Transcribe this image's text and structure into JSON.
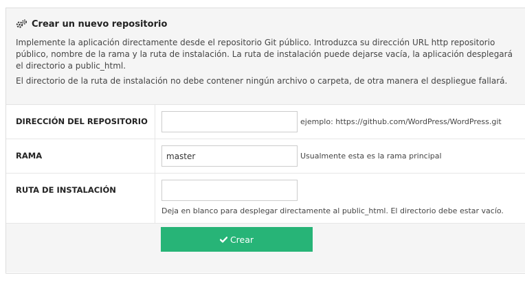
{
  "panel": {
    "title": "Crear un nuevo repositorio",
    "title_icon": "gears-icon",
    "description": [
      "Implemente la aplicación directamente desde el repositorio Git público. Introduzca su dirección URL http repositorio público, nombre de la rama y la ruta de instalación. La ruta de instalación puede dejarse vacía, la aplicación desplegará el directorio a public_html.",
      "El directorio de la ruta de instalación no debe contener ningún archivo o carpeta, de otra manera el despliegue fallará."
    ]
  },
  "form": {
    "repo": {
      "label": "DIRECCIÓN DEL REPOSITORIO",
      "value": "",
      "hint": "ejemplo: https://github.com/WordPress/WordPress.git"
    },
    "branch": {
      "label": "RAMA",
      "value": "master",
      "hint": "Usualmente esta es la rama principal"
    },
    "path": {
      "label": "RUTA DE INSTALACIÓN",
      "value": "",
      "hint": "Deja en blanco para desplegar directamente al public_html. El directorio debe estar vacío."
    }
  },
  "actions": {
    "create_label": "Crear",
    "create_icon": "check-icon",
    "button_color": "#27b477"
  }
}
